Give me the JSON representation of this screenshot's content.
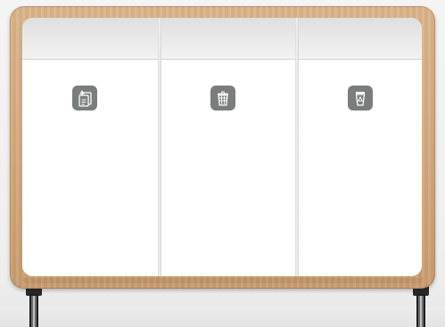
{
  "station": {
    "bays": [
      {
        "icon": "paper-recycling-icon",
        "label": ""
      },
      {
        "icon": "trash-bin-icon",
        "label": ""
      },
      {
        "icon": "cup-recycling-icon",
        "label": ""
      }
    ]
  },
  "colors": {
    "frame_wood": "#d4aa7f",
    "panel": "#ffffff",
    "icon_badge": "#7a7d7c",
    "legs": "#2a2a2a"
  }
}
